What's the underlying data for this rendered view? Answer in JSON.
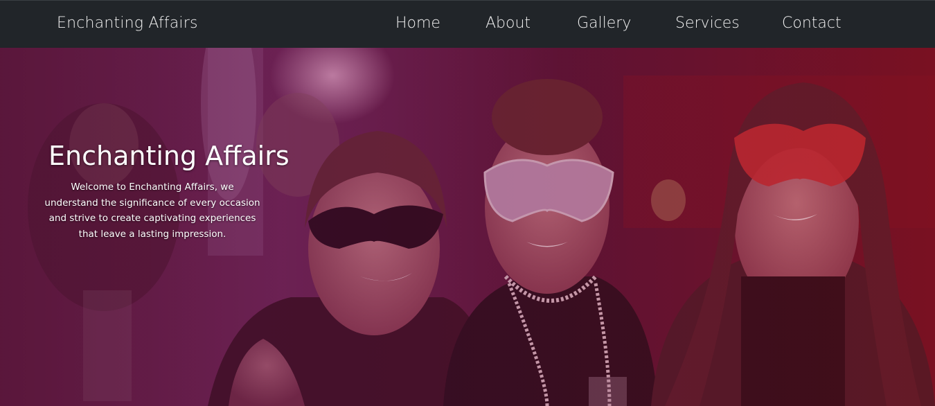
{
  "navbar": {
    "brand": "Enchanting Affairs",
    "links": [
      {
        "label": "Home"
      },
      {
        "label": "About"
      },
      {
        "label": "Gallery"
      },
      {
        "label": "Services"
      },
      {
        "label": "Contact"
      }
    ]
  },
  "hero": {
    "title": "Enchanting Affairs",
    "text": "Welcome to Enchanting Affairs, we understand the significance of every occasion and strive to create captivating experiences that leave a lasting impression."
  },
  "colors": {
    "navbar_bg": "#212529",
    "nav_text": "#f1f1f1",
    "hero_tint": "#7a1a4a"
  }
}
